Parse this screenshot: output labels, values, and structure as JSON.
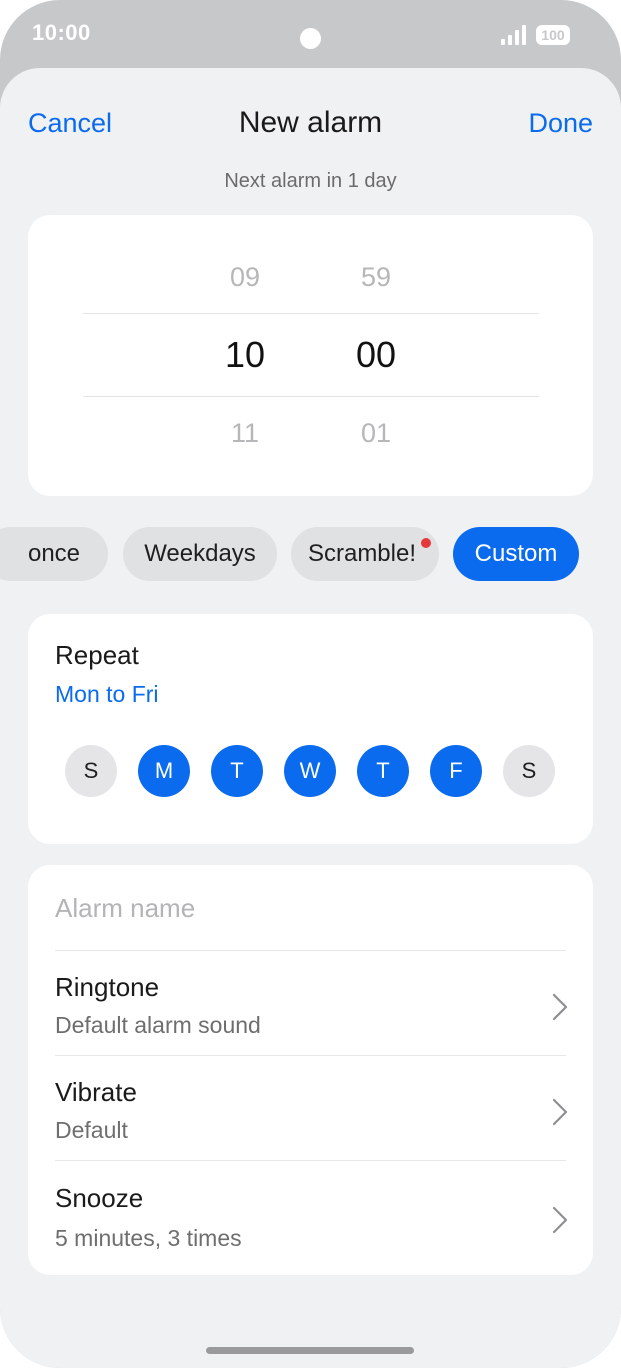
{
  "status_bar": {
    "time": "10:00",
    "battery": "100"
  },
  "header": {
    "cancel_label": "Cancel",
    "title": "New alarm",
    "done_label": "Done",
    "subtitle": "Next alarm in 1 day"
  },
  "time_picker": {
    "hours": {
      "prev": "09",
      "selected": "10",
      "next": "11"
    },
    "minutes": {
      "prev": "59",
      "selected": "00",
      "next": "01"
    }
  },
  "presets": [
    {
      "label": "once",
      "active": false
    },
    {
      "label": "Weekdays",
      "active": false
    },
    {
      "label": "Scramble!",
      "active": false,
      "badge_color": "#e5383b"
    },
    {
      "label": "Custom",
      "active": true
    }
  ],
  "repeat": {
    "title": "Repeat",
    "summary": "Mon to Fri",
    "days": [
      {
        "label": "S",
        "on": false
      },
      {
        "label": "M",
        "on": true
      },
      {
        "label": "T",
        "on": true
      },
      {
        "label": "W",
        "on": true
      },
      {
        "label": "T",
        "on": true
      },
      {
        "label": "F",
        "on": true
      },
      {
        "label": "S",
        "on": false
      }
    ]
  },
  "settings": {
    "alarm_name_placeholder": "Alarm name",
    "ringtone": {
      "title": "Ringtone",
      "value": "Default alarm sound"
    },
    "vibrate": {
      "title": "Vibrate",
      "value": "Default"
    },
    "snooze": {
      "title": "Snooze",
      "value": "5 minutes, 3 times"
    }
  },
  "colors": {
    "accent": "#0b6bee",
    "background": "#f0f1f3",
    "card": "#ffffff",
    "badge": "#e5383b"
  }
}
